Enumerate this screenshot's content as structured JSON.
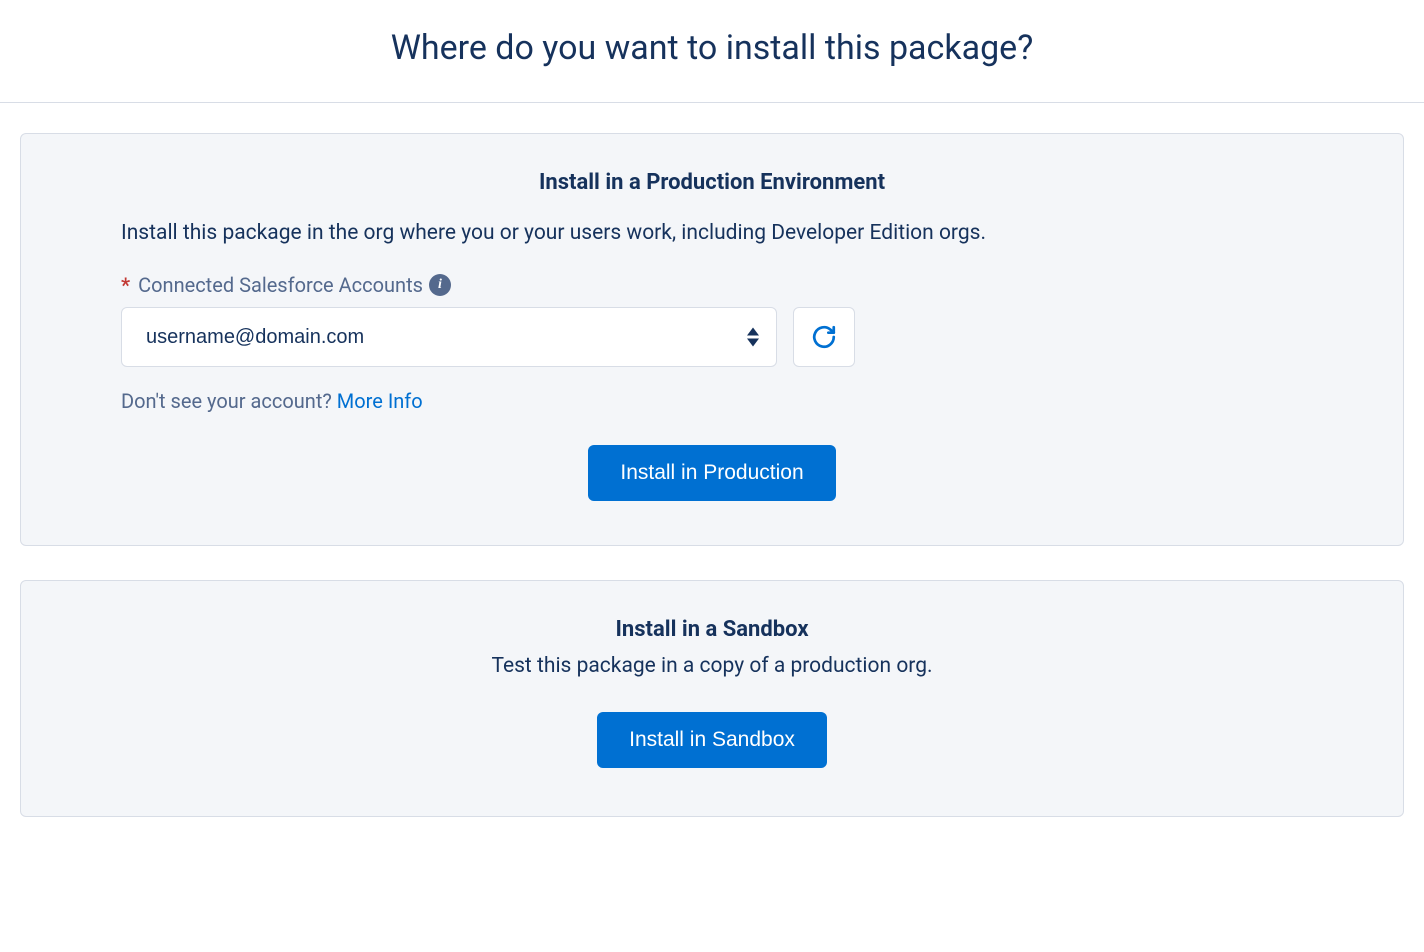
{
  "header": {
    "title": "Where do you want to install this package?"
  },
  "production": {
    "title": "Install in a Production Environment",
    "description": "Install this package in the org where you or your users work, including Developer Edition orgs.",
    "field_label": "Connected Salesforce Accounts",
    "required_marker": "*",
    "info_icon_text": "i",
    "selected_account": "username@domain.com",
    "help_prefix": "Don't see your account? ",
    "help_link": "More Info",
    "button_label": "Install in Production"
  },
  "sandbox": {
    "title": "Install in a Sandbox",
    "description": "Test this package in a copy of a production org.",
    "button_label": "Install in Sandbox"
  }
}
